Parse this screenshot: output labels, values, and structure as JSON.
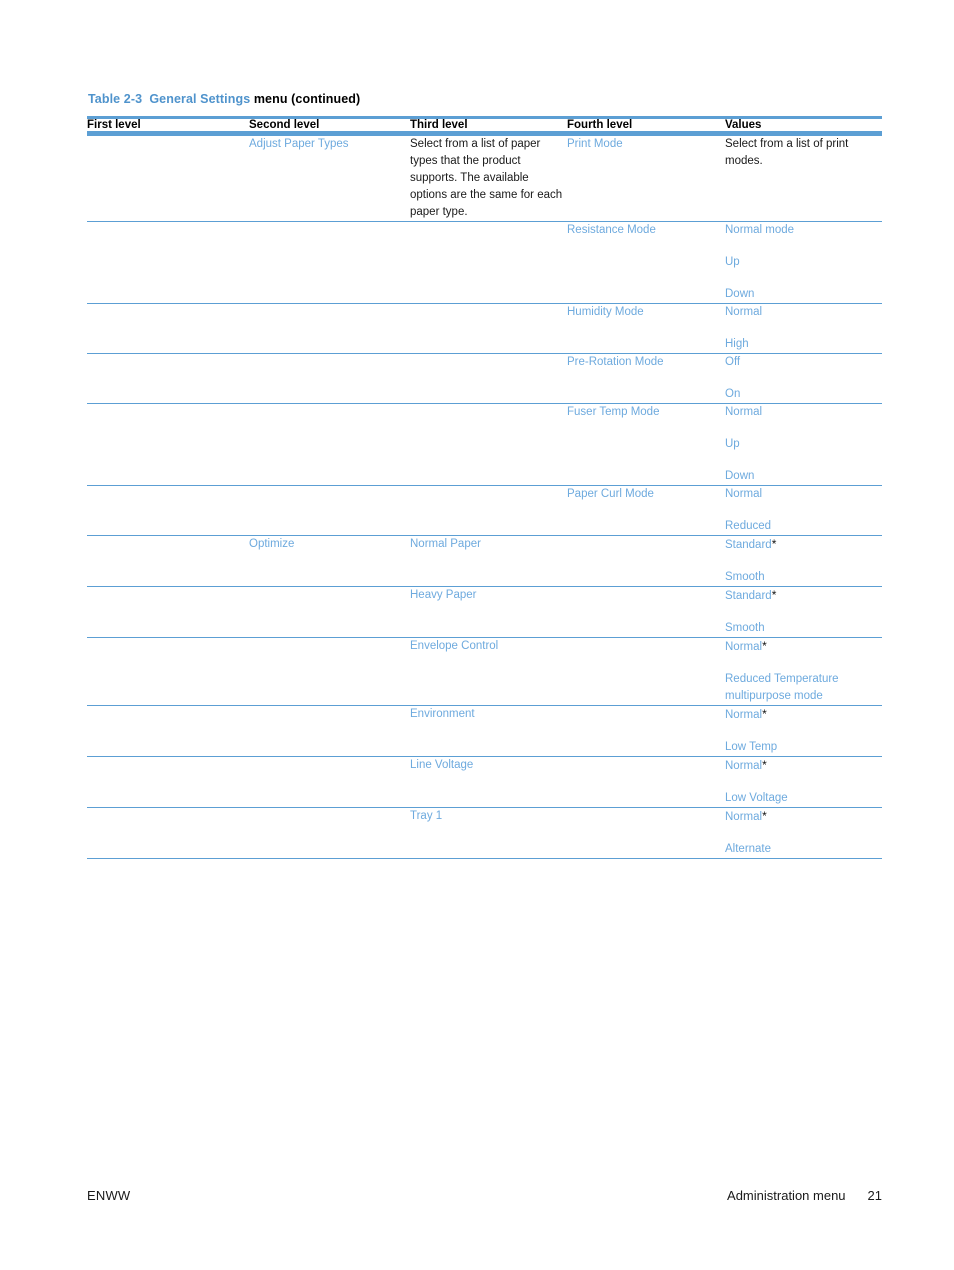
{
  "caption": {
    "table_number": "Table 2-3",
    "table_name": "General Settings",
    "suffix": "menu (continued)"
  },
  "table": {
    "headers": [
      "First level",
      "Second level",
      "Third level",
      "Fourth level",
      "Values"
    ],
    "rows": [
      {
        "first": "",
        "second": "Adjust Paper Types",
        "third": "Select from a list of paper types that the product supports. The available options are the same for each paper type.",
        "third_plain": true,
        "fourth": [
          "Print Mode"
        ],
        "values": [
          "Select from a list of print modes."
        ],
        "values_plain": true
      },
      {
        "first": "",
        "second": "",
        "third": "",
        "fourth": [
          "Resistance Mode"
        ],
        "values": [
          "Normal mode",
          "Up",
          "Down"
        ]
      },
      {
        "first": "",
        "second": "",
        "third": "",
        "fourth": [
          "Humidity Mode"
        ],
        "values": [
          "Normal",
          "High"
        ]
      },
      {
        "first": "",
        "second": "",
        "third": "",
        "fourth": [
          "Pre-Rotation Mode"
        ],
        "values": [
          "Off",
          "On"
        ]
      },
      {
        "first": "",
        "second": "",
        "third": "",
        "fourth": [
          "Fuser Temp Mode"
        ],
        "values": [
          "Normal",
          "Up",
          "Down"
        ]
      },
      {
        "first": "",
        "second": "",
        "third": "",
        "fourth": [
          "Paper Curl Mode"
        ],
        "values": [
          "Normal",
          "Reduced"
        ]
      },
      {
        "first": "",
        "second": "Optimize",
        "third": "Normal Paper",
        "fourth": [],
        "values": [
          "Standard*",
          "Smooth"
        ]
      },
      {
        "first": "",
        "second": "",
        "third": "Heavy Paper",
        "fourth": [],
        "values": [
          "Standard*",
          "Smooth"
        ]
      },
      {
        "first": "",
        "second": "",
        "third": "Envelope Control",
        "fourth": [],
        "values": [
          "Normal*",
          "Reduced Temperature multipurpose mode"
        ]
      },
      {
        "first": "",
        "second": "",
        "third": "Environment",
        "fourth": [],
        "values": [
          "Normal*",
          "Low Temp"
        ]
      },
      {
        "first": "",
        "second": "",
        "third": "Line Voltage",
        "fourth": [],
        "values": [
          "Normal*",
          "Low Voltage"
        ]
      },
      {
        "first": "",
        "second": "",
        "third": "Tray 1",
        "fourth": [],
        "values": [
          "Normal*",
          "Alternate"
        ]
      }
    ]
  },
  "footer": {
    "left": "ENWW",
    "chapter": "Administration menu",
    "page_number": "21"
  },
  "colors": {
    "rule_blue": "#5c9fd4",
    "link_blue": "#6eaade",
    "caption_blue": "#4f93cc",
    "body_black": "#1a1a1a"
  }
}
